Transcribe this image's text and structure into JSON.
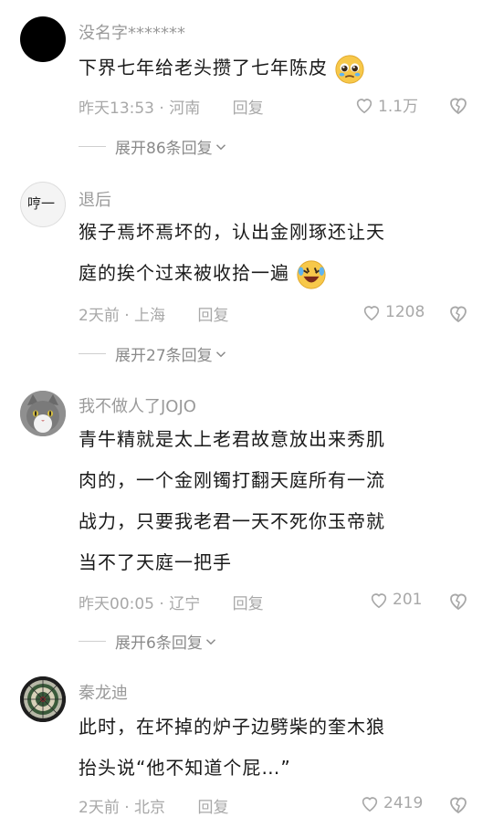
{
  "comments": [
    {
      "username": "没名字*******",
      "text": "下界七年给老头攒了七年陈皮",
      "emoji": "pleading-face",
      "time": "昨天13:53",
      "location": "河南",
      "reply_label": "回复",
      "likes": "1.1万",
      "expand_label": "展开86条回复"
    },
    {
      "username": "退后",
      "avatar_text": "哼一",
      "text_lines": [
        "猴子焉坏焉坏的，认出金刚琢还让天",
        "庭的挨个过来被收拾一遍"
      ],
      "emoji": "rolling-laughing-face",
      "time": "2天前",
      "location": "上海",
      "reply_label": "回复",
      "likes": "1208",
      "expand_label": "展开27条回复"
    },
    {
      "username": "我不做人了JOJO",
      "text_lines": [
        "青牛精就是太上老君故意放出来秀肌",
        "肉的，一个金刚镯打翻天庭所有一流",
        "战力，只要我老君一天不死你玉帝就",
        "当不了天庭一把手"
      ],
      "time": "昨天00:05",
      "location": "辽宁",
      "reply_label": "回复",
      "likes": "201",
      "expand_label": "展开6条回复"
    },
    {
      "username": "秦龙迪",
      "text_lines": [
        "此时，在坏掉的炉子边劈柴的奎木狼",
        "抬头说“他不知道个屁…”"
      ],
      "time": "2天前",
      "location": "北京",
      "reply_label": "回复",
      "likes": "2419"
    }
  ],
  "separator": "·"
}
